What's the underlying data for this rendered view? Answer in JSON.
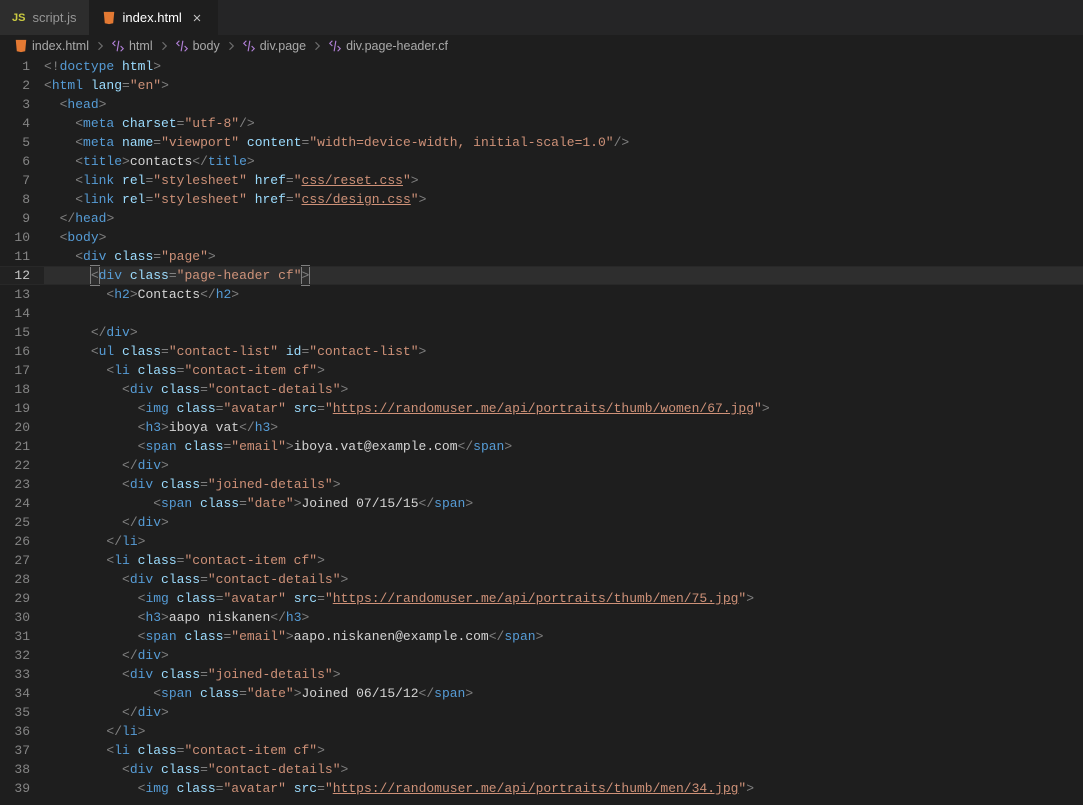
{
  "tabs": [
    {
      "label": "script.js",
      "icon": "js",
      "active": false
    },
    {
      "label": "index.html",
      "icon": "html",
      "active": true
    }
  ],
  "breadcrumbs": [
    {
      "icon": "html",
      "label": "index.html"
    },
    {
      "icon": "sym",
      "label": "html"
    },
    {
      "icon": "sym",
      "label": "body"
    },
    {
      "icon": "sym",
      "label": "div.page"
    },
    {
      "icon": "sym",
      "label": "div.page-header.cf"
    }
  ],
  "current_line": 12,
  "lines": [
    {
      "n": 1,
      "indent": 0,
      "tokens": [
        [
          "p",
          "<!"
        ],
        [
          "d",
          "doctype "
        ],
        [
          "a",
          "html"
        ],
        [
          "p",
          ">"
        ]
      ]
    },
    {
      "n": 2,
      "indent": 0,
      "tokens": [
        [
          "p",
          "<"
        ],
        [
          "t",
          "html "
        ],
        [
          "a",
          "lang"
        ],
        [
          "p",
          "="
        ],
        [
          "s",
          "\"en\""
        ],
        [
          "p",
          ">"
        ]
      ]
    },
    {
      "n": 3,
      "indent": 1,
      "tokens": [
        [
          "p",
          "<"
        ],
        [
          "t",
          "head"
        ],
        [
          "p",
          ">"
        ]
      ]
    },
    {
      "n": 4,
      "indent": 2,
      "tokens": [
        [
          "p",
          "<"
        ],
        [
          "t",
          "meta "
        ],
        [
          "a",
          "charset"
        ],
        [
          "p",
          "="
        ],
        [
          "s",
          "\"utf-8\""
        ],
        [
          "p",
          "/>"
        ]
      ]
    },
    {
      "n": 5,
      "indent": 2,
      "tokens": [
        [
          "p",
          "<"
        ],
        [
          "t",
          "meta "
        ],
        [
          "a",
          "name"
        ],
        [
          "p",
          "="
        ],
        [
          "s",
          "\"viewport\""
        ],
        [
          "a",
          " content"
        ],
        [
          "p",
          "="
        ],
        [
          "s",
          "\"width=device-width, initial-scale=1.0\""
        ],
        [
          "p",
          "/>"
        ]
      ]
    },
    {
      "n": 6,
      "indent": 2,
      "tokens": [
        [
          "p",
          "<"
        ],
        [
          "t",
          "title"
        ],
        [
          "p",
          ">"
        ],
        [
          "tx",
          "contacts"
        ],
        [
          "p",
          "</"
        ],
        [
          "t",
          "title"
        ],
        [
          "p",
          ">"
        ]
      ]
    },
    {
      "n": 7,
      "indent": 2,
      "tokens": [
        [
          "p",
          "<"
        ],
        [
          "t",
          "link "
        ],
        [
          "a",
          "rel"
        ],
        [
          "p",
          "="
        ],
        [
          "s",
          "\"stylesheet\""
        ],
        [
          "a",
          " href"
        ],
        [
          "p",
          "="
        ],
        [
          "s",
          "\""
        ],
        [
          "su",
          "css/reset.css"
        ],
        [
          "s",
          "\""
        ],
        [
          "p",
          ">"
        ]
      ]
    },
    {
      "n": 8,
      "indent": 2,
      "tokens": [
        [
          "p",
          "<"
        ],
        [
          "t",
          "link "
        ],
        [
          "a",
          "rel"
        ],
        [
          "p",
          "="
        ],
        [
          "s",
          "\"stylesheet\""
        ],
        [
          "a",
          " href"
        ],
        [
          "p",
          "="
        ],
        [
          "s",
          "\""
        ],
        [
          "su",
          "css/design.css"
        ],
        [
          "s",
          "\""
        ],
        [
          "p",
          ">"
        ]
      ]
    },
    {
      "n": 9,
      "indent": 1,
      "tokens": [
        [
          "p",
          "</"
        ],
        [
          "t",
          "head"
        ],
        [
          "p",
          ">"
        ]
      ]
    },
    {
      "n": 10,
      "indent": 1,
      "tokens": [
        [
          "p",
          "<"
        ],
        [
          "t",
          "body"
        ],
        [
          "p",
          ">"
        ]
      ]
    },
    {
      "n": 11,
      "indent": 2,
      "tokens": [
        [
          "p",
          "<"
        ],
        [
          "t",
          "div "
        ],
        [
          "a",
          "class"
        ],
        [
          "p",
          "="
        ],
        [
          "s",
          "\"page\""
        ],
        [
          "p",
          ">"
        ]
      ]
    },
    {
      "n": 12,
      "indent": 3,
      "tokens": [
        [
          "p",
          "["
        ],
        [
          "p",
          "<"
        ],
        [
          "t",
          "div "
        ],
        [
          "a",
          "class"
        ],
        [
          "p",
          "="
        ],
        [
          "s",
          "\"page-header cf\""
        ],
        [
          "p",
          ">"
        ],
        [
          "p",
          "]"
        ]
      ]
    },
    {
      "n": 13,
      "indent": 4,
      "tokens": [
        [
          "p",
          "<"
        ],
        [
          "t",
          "h2"
        ],
        [
          "p",
          ">"
        ],
        [
          "tx",
          "Contacts"
        ],
        [
          "p",
          "</"
        ],
        [
          "t",
          "h2"
        ],
        [
          "p",
          ">"
        ]
      ]
    },
    {
      "n": 14,
      "indent": 0,
      "tokens": []
    },
    {
      "n": 15,
      "indent": 3,
      "tokens": [
        [
          "p",
          "</"
        ],
        [
          "t",
          "div"
        ],
        [
          "p",
          ">"
        ]
      ]
    },
    {
      "n": 16,
      "indent": 3,
      "tokens": [
        [
          "p",
          "<"
        ],
        [
          "t",
          "ul "
        ],
        [
          "a",
          "class"
        ],
        [
          "p",
          "="
        ],
        [
          "s",
          "\"contact-list\""
        ],
        [
          "a",
          " id"
        ],
        [
          "p",
          "="
        ],
        [
          "s",
          "\"contact-list\""
        ],
        [
          "p",
          ">"
        ]
      ]
    },
    {
      "n": 17,
      "indent": 4,
      "tokens": [
        [
          "p",
          "<"
        ],
        [
          "t",
          "li "
        ],
        [
          "a",
          "class"
        ],
        [
          "p",
          "="
        ],
        [
          "s",
          "\"contact-item cf\""
        ],
        [
          "p",
          ">"
        ]
      ]
    },
    {
      "n": 18,
      "indent": 5,
      "tokens": [
        [
          "p",
          "<"
        ],
        [
          "t",
          "div "
        ],
        [
          "a",
          "class"
        ],
        [
          "p",
          "="
        ],
        [
          "s",
          "\"contact-details\""
        ],
        [
          "p",
          ">"
        ]
      ]
    },
    {
      "n": 19,
      "indent": 6,
      "tokens": [
        [
          "p",
          "<"
        ],
        [
          "t",
          "img "
        ],
        [
          "a",
          "class"
        ],
        [
          "p",
          "="
        ],
        [
          "s",
          "\"avatar\""
        ],
        [
          "a",
          " src"
        ],
        [
          "p",
          "="
        ],
        [
          "s",
          "\""
        ],
        [
          "su",
          "https://randomuser.me/api/portraits/thumb/women/67.jpg"
        ],
        [
          "s",
          "\""
        ],
        [
          "p",
          ">"
        ]
      ]
    },
    {
      "n": 20,
      "indent": 6,
      "tokens": [
        [
          "p",
          "<"
        ],
        [
          "t",
          "h3"
        ],
        [
          "p",
          ">"
        ],
        [
          "tx",
          "iboya vat"
        ],
        [
          "p",
          "</"
        ],
        [
          "t",
          "h3"
        ],
        [
          "p",
          ">"
        ]
      ]
    },
    {
      "n": 21,
      "indent": 6,
      "tokens": [
        [
          "p",
          "<"
        ],
        [
          "t",
          "span "
        ],
        [
          "a",
          "class"
        ],
        [
          "p",
          "="
        ],
        [
          "s",
          "\"email\""
        ],
        [
          "p",
          ">"
        ],
        [
          "tx",
          "iboya.vat@example.com"
        ],
        [
          "p",
          "</"
        ],
        [
          "t",
          "span"
        ],
        [
          "p",
          ">"
        ]
      ]
    },
    {
      "n": 22,
      "indent": 5,
      "tokens": [
        [
          "p",
          "</"
        ],
        [
          "t",
          "div"
        ],
        [
          "p",
          ">"
        ]
      ]
    },
    {
      "n": 23,
      "indent": 5,
      "tokens": [
        [
          "p",
          "<"
        ],
        [
          "t",
          "div "
        ],
        [
          "a",
          "class"
        ],
        [
          "p",
          "="
        ],
        [
          "s",
          "\"joined-details\""
        ],
        [
          "p",
          ">"
        ]
      ]
    },
    {
      "n": 24,
      "indent": 7,
      "tokens": [
        [
          "p",
          "<"
        ],
        [
          "t",
          "span "
        ],
        [
          "a",
          "class"
        ],
        [
          "p",
          "="
        ],
        [
          "s",
          "\"date\""
        ],
        [
          "p",
          ">"
        ],
        [
          "tx",
          "Joined 07/15/15"
        ],
        [
          "p",
          "</"
        ],
        [
          "t",
          "span"
        ],
        [
          "p",
          ">"
        ]
      ]
    },
    {
      "n": 25,
      "indent": 5,
      "tokens": [
        [
          "p",
          "</"
        ],
        [
          "t",
          "div"
        ],
        [
          "p",
          ">"
        ]
      ]
    },
    {
      "n": 26,
      "indent": 4,
      "tokens": [
        [
          "p",
          "</"
        ],
        [
          "t",
          "li"
        ],
        [
          "p",
          ">"
        ]
      ]
    },
    {
      "n": 27,
      "indent": 4,
      "tokens": [
        [
          "p",
          "<"
        ],
        [
          "t",
          "li "
        ],
        [
          "a",
          "class"
        ],
        [
          "p",
          "="
        ],
        [
          "s",
          "\"contact-item cf\""
        ],
        [
          "p",
          ">"
        ]
      ]
    },
    {
      "n": 28,
      "indent": 5,
      "tokens": [
        [
          "p",
          "<"
        ],
        [
          "t",
          "div "
        ],
        [
          "a",
          "class"
        ],
        [
          "p",
          "="
        ],
        [
          "s",
          "\"contact-details\""
        ],
        [
          "p",
          ">"
        ]
      ]
    },
    {
      "n": 29,
      "indent": 6,
      "tokens": [
        [
          "p",
          "<"
        ],
        [
          "t",
          "img "
        ],
        [
          "a",
          "class"
        ],
        [
          "p",
          "="
        ],
        [
          "s",
          "\"avatar\""
        ],
        [
          "a",
          " src"
        ],
        [
          "p",
          "="
        ],
        [
          "s",
          "\""
        ],
        [
          "su",
          "https://randomuser.me/api/portraits/thumb/men/75.jpg"
        ],
        [
          "s",
          "\""
        ],
        [
          "p",
          ">"
        ]
      ]
    },
    {
      "n": 30,
      "indent": 6,
      "tokens": [
        [
          "p",
          "<"
        ],
        [
          "t",
          "h3"
        ],
        [
          "p",
          ">"
        ],
        [
          "tx",
          "aapo niskanen"
        ],
        [
          "p",
          "</"
        ],
        [
          "t",
          "h3"
        ],
        [
          "p",
          ">"
        ]
      ]
    },
    {
      "n": 31,
      "indent": 6,
      "tokens": [
        [
          "p",
          "<"
        ],
        [
          "t",
          "span "
        ],
        [
          "a",
          "class"
        ],
        [
          "p",
          "="
        ],
        [
          "s",
          "\"email\""
        ],
        [
          "p",
          ">"
        ],
        [
          "tx",
          "aapo.niskanen@example.com"
        ],
        [
          "p",
          "</"
        ],
        [
          "t",
          "span"
        ],
        [
          "p",
          ">"
        ]
      ]
    },
    {
      "n": 32,
      "indent": 5,
      "tokens": [
        [
          "p",
          "</"
        ],
        [
          "t",
          "div"
        ],
        [
          "p",
          ">"
        ]
      ]
    },
    {
      "n": 33,
      "indent": 5,
      "tokens": [
        [
          "p",
          "<"
        ],
        [
          "t",
          "div "
        ],
        [
          "a",
          "class"
        ],
        [
          "p",
          "="
        ],
        [
          "s",
          "\"joined-details\""
        ],
        [
          "p",
          ">"
        ]
      ]
    },
    {
      "n": 34,
      "indent": 7,
      "tokens": [
        [
          "p",
          "<"
        ],
        [
          "t",
          "span "
        ],
        [
          "a",
          "class"
        ],
        [
          "p",
          "="
        ],
        [
          "s",
          "\"date\""
        ],
        [
          "p",
          ">"
        ],
        [
          "tx",
          "Joined 06/15/12"
        ],
        [
          "p",
          "</"
        ],
        [
          "t",
          "span"
        ],
        [
          "p",
          ">"
        ]
      ]
    },
    {
      "n": 35,
      "indent": 5,
      "tokens": [
        [
          "p",
          "</"
        ],
        [
          "t",
          "div"
        ],
        [
          "p",
          ">"
        ]
      ]
    },
    {
      "n": 36,
      "indent": 4,
      "tokens": [
        [
          "p",
          "</"
        ],
        [
          "t",
          "li"
        ],
        [
          "p",
          ">"
        ]
      ]
    },
    {
      "n": 37,
      "indent": 4,
      "tokens": [
        [
          "p",
          "<"
        ],
        [
          "t",
          "li "
        ],
        [
          "a",
          "class"
        ],
        [
          "p",
          "="
        ],
        [
          "s",
          "\"contact-item cf\""
        ],
        [
          "p",
          ">"
        ]
      ]
    },
    {
      "n": 38,
      "indent": 5,
      "tokens": [
        [
          "p",
          "<"
        ],
        [
          "t",
          "div "
        ],
        [
          "a",
          "class"
        ],
        [
          "p",
          "="
        ],
        [
          "s",
          "\"contact-details\""
        ],
        [
          "p",
          ">"
        ]
      ]
    },
    {
      "n": 39,
      "indent": 6,
      "tokens": [
        [
          "p",
          "<"
        ],
        [
          "t",
          "img "
        ],
        [
          "a",
          "class"
        ],
        [
          "p",
          "="
        ],
        [
          "s",
          "\"avatar\""
        ],
        [
          "a",
          " src"
        ],
        [
          "p",
          "="
        ],
        [
          "s",
          "\""
        ],
        [
          "su",
          "https://randomuser.me/api/portraits/thumb/men/34.jpg"
        ],
        [
          "s",
          "\""
        ],
        [
          "p",
          ">"
        ]
      ]
    }
  ]
}
